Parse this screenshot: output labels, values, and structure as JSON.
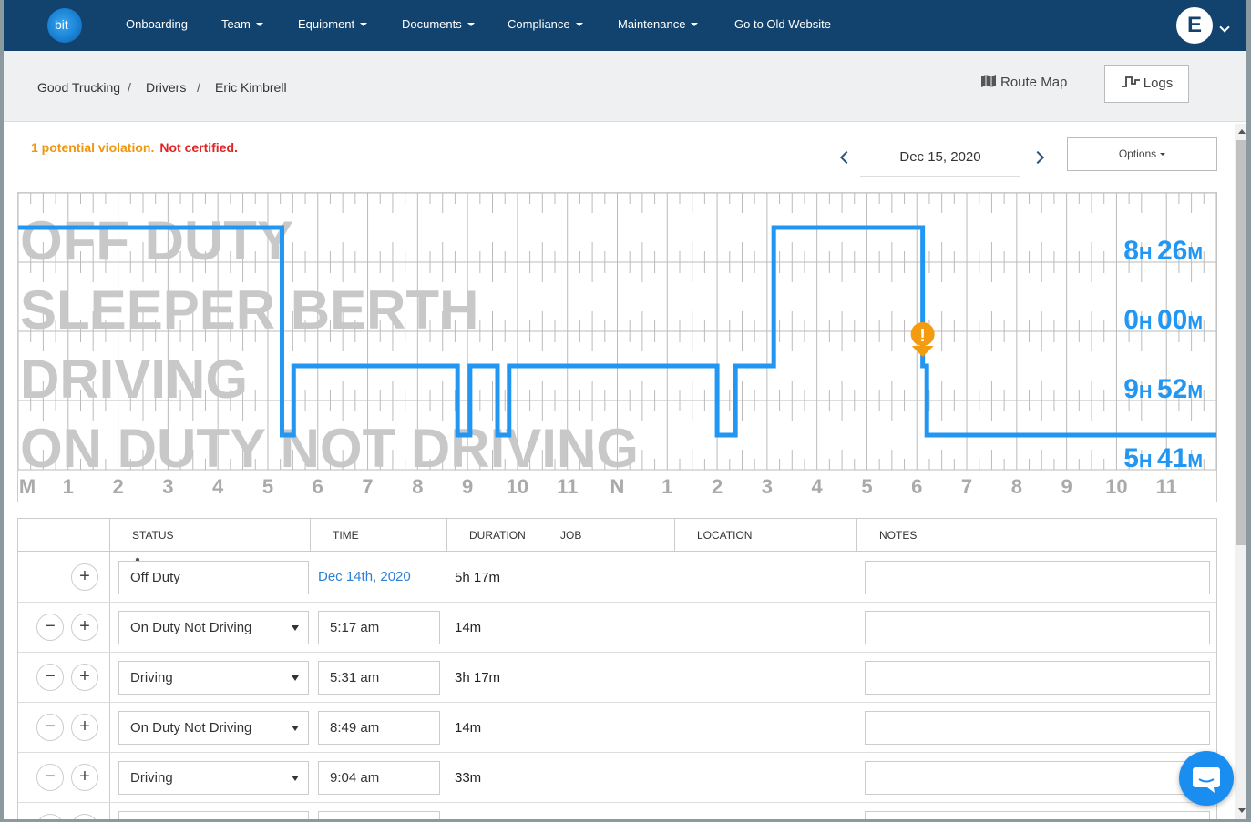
{
  "navbar": {
    "logo_text": "bit",
    "items": [
      {
        "label": "Onboarding",
        "dropdown": false
      },
      {
        "label": "Team",
        "dropdown": true
      },
      {
        "label": "Equipment",
        "dropdown": true
      },
      {
        "label": "Documents",
        "dropdown": true
      },
      {
        "label": "Compliance",
        "dropdown": true
      },
      {
        "label": "Maintenance",
        "dropdown": true
      },
      {
        "label": "Go to Old Website",
        "dropdown": false
      }
    ],
    "avatar_letter": "E"
  },
  "breadcrumb": [
    "Good Trucking",
    "Drivers",
    "Eric Kimbrell"
  ],
  "breadcrumb_sep": "/",
  "actions": {
    "route_map": "Route Map",
    "logs": "Logs"
  },
  "alerts": {
    "violation": "1 potential violation.",
    "certification": "Not certified."
  },
  "date_nav": {
    "date": "Dec 15, 2020",
    "options": "Options"
  },
  "log_graph": {
    "rows": [
      "OFF DUTY",
      "SLEEPER BERTH",
      "DRIVING",
      "ON DUTY NOT DRIVING"
    ],
    "totals": [
      {
        "h": "8",
        "m": "26"
      },
      {
        "h": "0",
        "m": "00"
      },
      {
        "h": "9",
        "m": "52"
      },
      {
        "h": "5",
        "m": "41"
      }
    ],
    "hour_labels": [
      "M",
      "1",
      "2",
      "3",
      "4",
      "5",
      "6",
      "7",
      "8",
      "9",
      "10",
      "11",
      "N",
      "1",
      "2",
      "3",
      "4",
      "5",
      "6",
      "7",
      "8",
      "9",
      "10",
      "11"
    ],
    "unit_h": "H",
    "unit_m": "M",
    "line_color": "#2196f3",
    "violation_color": "#f39c12"
  },
  "table": {
    "headers": [
      "STATUS",
      "TIME",
      "DURATION",
      "JOB",
      "LOCATION",
      "NOTES"
    ],
    "rows": [
      {
        "status": "Off Duty",
        "time": "Dec 14th, 2020",
        "duration": "5h 17m",
        "first": true
      },
      {
        "status": "On Duty Not Driving",
        "time": "5:17 am",
        "duration": "14m"
      },
      {
        "status": "Driving",
        "time": "5:31 am",
        "duration": "3h 17m"
      },
      {
        "status": "On Duty Not Driving",
        "time": "8:49 am",
        "duration": "14m"
      },
      {
        "status": "Driving",
        "time": "9:04 am",
        "duration": "33m"
      }
    ]
  }
}
